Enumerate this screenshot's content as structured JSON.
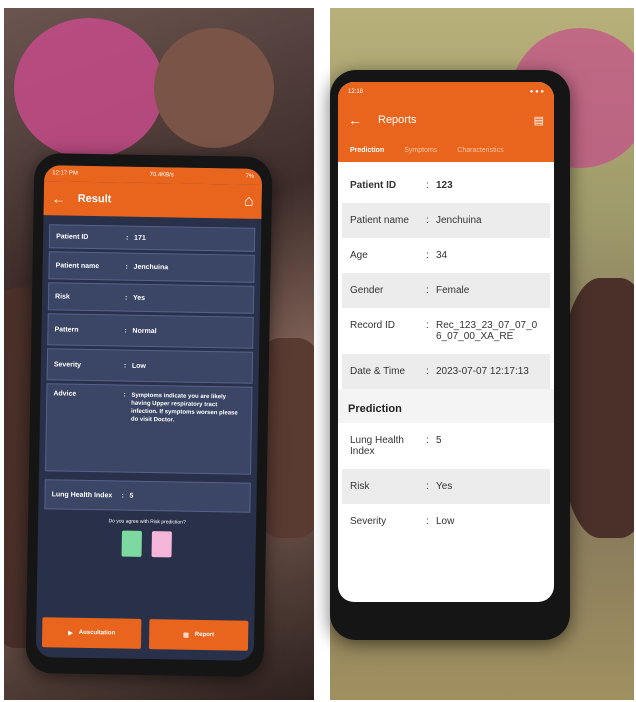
{
  "left_phone": {
    "status_time": "12:17 PM",
    "status_net": "70.4KB/s",
    "status_right": "7%",
    "title": "Result",
    "rows": [
      {
        "key": "Patient ID",
        "value": "171"
      },
      {
        "key": "Patient name",
        "value": "Jenchuina"
      },
      {
        "key": "Risk",
        "value": "Yes"
      },
      {
        "key": "Pattern",
        "value": "Normal"
      },
      {
        "key": "Severity",
        "value": "Low"
      },
      {
        "key": "Advice",
        "value": "Symptoms indicate you are likely having Upper respiratory tract infection. If symptoms worsen please do visit Doctor."
      },
      {
        "key": "Lung Health Index",
        "value": "5"
      }
    ],
    "question": "Do you agree with Risk prediction?",
    "vote_colors": [
      "#7ed9a0",
      "#f4b5d8"
    ],
    "buttons": {
      "play": "Auscultation",
      "report": "Report"
    }
  },
  "right_phone": {
    "status_time": "12:18",
    "title": "Reports",
    "tabs": [
      "Prediction",
      "Symptoms",
      "Characteristics"
    ],
    "rows": [
      {
        "key": "Patient ID",
        "value": "123"
      },
      {
        "key": "Patient name",
        "value": "Jenchuina"
      },
      {
        "key": "Age",
        "value": "34"
      },
      {
        "key": "Gender",
        "value": "Female"
      },
      {
        "key": "Record ID",
        "value": "Rec_123_23_07_07_06_07_00_XA_RE"
      },
      {
        "key": "Date & Time",
        "value": "2023-07-07 12:17:13"
      }
    ],
    "section": "Prediction",
    "prediction_rows": [
      {
        "key": "Lung Health Index",
        "value": "5"
      },
      {
        "key": "Risk",
        "value": "Yes"
      },
      {
        "key": "Severity",
        "value": "Low"
      }
    ]
  },
  "colors": {
    "accent": "#e9651e",
    "left_screen_bg": "#283149",
    "right_screen_bg": "#ffffff"
  }
}
